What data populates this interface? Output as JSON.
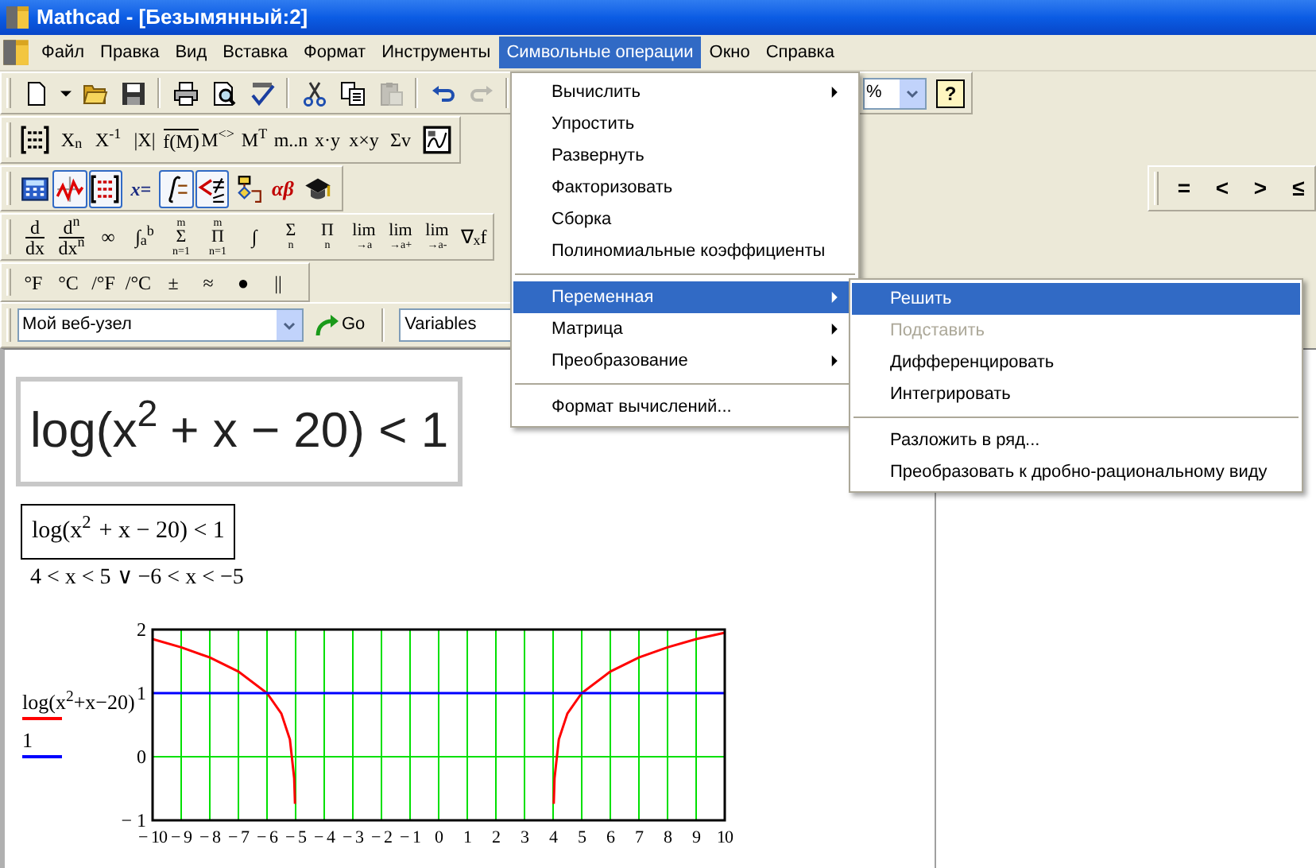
{
  "window": {
    "title": "Mathcad - [Безымянный:2]"
  },
  "menu_bar": [
    {
      "label": "Файл",
      "selected": false
    },
    {
      "label": "Правка",
      "selected": false
    },
    {
      "label": "Вид",
      "selected": false
    },
    {
      "label": "Вставка",
      "selected": false
    },
    {
      "label": "Формат",
      "selected": false
    },
    {
      "label": "Инструменты",
      "selected": false
    },
    {
      "label": "Символьные операции",
      "selected": true
    },
    {
      "label": "Окно",
      "selected": false
    },
    {
      "label": "Справка",
      "selected": false
    }
  ],
  "standard_toolbar": {
    "groups": [
      [
        {
          "kind": "new",
          "disabled": false
        },
        {
          "kind": "dropdown",
          "disabled": false
        },
        {
          "kind": "open",
          "disabled": false
        },
        {
          "kind": "save",
          "disabled": false
        }
      ],
      [
        {
          "kind": "print",
          "disabled": false
        },
        {
          "kind": "preview",
          "disabled": false
        },
        {
          "kind": "spell",
          "disabled": false
        }
      ],
      [
        {
          "kind": "cut",
          "disabled": false
        },
        {
          "kind": "copy",
          "disabled": false
        },
        {
          "kind": "paste",
          "disabled": true
        }
      ],
      [
        {
          "kind": "undo",
          "disabled": false
        },
        {
          "kind": "redo",
          "disabled": true
        }
      ]
    ],
    "zoom": "%",
    "help": "?"
  },
  "matrix_toolbar": [
    {
      "kind": "matrix"
    },
    {
      "kind": "text",
      "label": "X$_{n}$"
    },
    {
      "kind": "text",
      "label": "X$^{-1}$"
    },
    {
      "kind": "text",
      "label": "|X|"
    },
    {
      "kind": "vector",
      "label": "f(M)"
    },
    {
      "kind": "text",
      "label": "M$^{<>}$"
    },
    {
      "kind": "text",
      "label": "M$^{T}$"
    },
    {
      "kind": "text",
      "label": "m..n"
    },
    {
      "kind": "text",
      "label": "x·y"
    },
    {
      "kind": "text",
      "label": "x×y"
    },
    {
      "kind": "text",
      "label": "Σv"
    },
    {
      "kind": "picture_tool"
    }
  ],
  "math_toolbar": [
    {
      "kind": "calculator",
      "pressed": false
    },
    {
      "kind": "graph",
      "pressed": true
    },
    {
      "kind": "matrix_palette",
      "pressed": true
    },
    {
      "kind": "text",
      "label": "x=",
      "pressed": false
    },
    {
      "kind": "calculus",
      "pressed": true
    },
    {
      "kind": "boolean",
      "pressed": true
    },
    {
      "kind": "programming",
      "pressed": false
    },
    {
      "kind": "greek",
      "label": "αβ",
      "pressed": false
    },
    {
      "kind": "symbolic",
      "pressed": false
    }
  ],
  "calculus_toolbar": [
    {
      "kind": "frac",
      "top": "d",
      "bottom": "dx"
    },
    {
      "kind": "frac",
      "top": "d$^{n}$",
      "bottom": "dx$^{n}$"
    },
    {
      "kind": "text",
      "label": "∞"
    },
    {
      "kind": "text",
      "label": "∫$_{a}$$^{b}$"
    },
    {
      "kind": "stack",
      "top": "m",
      "mid": "Σ",
      "bottom": "n=1"
    },
    {
      "kind": "stack",
      "top": "m",
      "mid": "Π",
      "bottom": "n=1"
    },
    {
      "kind": "text",
      "label": "∫"
    },
    {
      "kind": "under",
      "mid": "Σ",
      "bottom": "n"
    },
    {
      "kind": "under",
      "mid": "Π",
      "bottom": "n"
    },
    {
      "kind": "under",
      "mid": "lim",
      "bottom": "→a"
    },
    {
      "kind": "under",
      "mid": "lim",
      "bottom": "→a+"
    },
    {
      "kind": "under",
      "mid": "lim",
      "bottom": "→a-"
    },
    {
      "kind": "text",
      "label": "∇$_{x}$f"
    }
  ],
  "units_toolbar": [
    "°F",
    "°C",
    "/°F",
    "/°C",
    "±",
    "≈",
    "●",
    "||"
  ],
  "boolean_toolbar": [
    "=",
    "<",
    ">",
    "≤"
  ],
  "resources_toolbar": {
    "site": "Мой веб-узел",
    "go": "Go",
    "variables": "Variables"
  },
  "worksheet": {
    "image_expression": "log(x$^{2}$ + x − 20) < 1",
    "expression": "log(x$^{2}$ + x − 20) < 1",
    "result": "4 < x < 5 ∨ −6 < x < −5",
    "plot": {
      "chart_data": {
        "type": "line",
        "grid": true,
        "xlim": [
          -10,
          10
        ],
        "ylim": [
          -1,
          2
        ],
        "x": [
          -10,
          -9,
          -8,
          -7,
          -6,
          -5.5,
          -5.2,
          -5.05,
          -5.02,
          0,
          4.02,
          4.05,
          4.2,
          4.5,
          5,
          6,
          7,
          8,
          9,
          10
        ],
        "series": [
          {
            "name": "log(x$^{2}$+x−20)",
            "color": "#ff0000",
            "values": [
              1.85,
              1.72,
              1.56,
              1.34,
              1,
              0.68,
              0.27,
              -0.34,
              -0.74,
              null,
              -0.74,
              -0.34,
              0.27,
              0.68,
              1,
              1.34,
              1.56,
              1.72,
              1.85,
              1.95
            ]
          },
          {
            "name": "1",
            "color": "#0000ff",
            "values": [
              1,
              1,
              1,
              1,
              1,
              1,
              1,
              1,
              1,
              1,
              1,
              1,
              1,
              1,
              1,
              1,
              1,
              1,
              1,
              1
            ]
          }
        ],
        "xticks": [
          {
            "value": -10,
            "label": "− 10"
          },
          {
            "value": -9,
            "label": "− 9"
          },
          {
            "value": -8,
            "label": "− 8"
          },
          {
            "value": -7,
            "label": "− 7"
          },
          {
            "value": -6,
            "label": "− 6"
          },
          {
            "value": -5,
            "label": "− 5"
          },
          {
            "value": -4,
            "label": "− 4"
          },
          {
            "value": -3,
            "label": "− 3"
          },
          {
            "value": -2,
            "label": "− 2"
          },
          {
            "value": -1,
            "label": "− 1"
          },
          0,
          1,
          2,
          3,
          4,
          5,
          6,
          7,
          8,
          9,
          10
        ],
        "yticks": [
          {
            "value": -1,
            "label": "− 1"
          },
          0,
          1,
          2
        ]
      }
    }
  },
  "symbolic_menu": [
    {
      "kind": "item",
      "label": "Вычислить",
      "submenu": true,
      "selected": false
    },
    {
      "kind": "item",
      "label": "Упростить",
      "submenu": false,
      "selected": false
    },
    {
      "kind": "item",
      "label": "Развернуть",
      "submenu": false,
      "selected": false
    },
    {
      "kind": "item",
      "label": "Факторизовать",
      "submenu": false,
      "selected": false
    },
    {
      "kind": "item",
      "label": "Сборка",
      "submenu": false,
      "selected": false
    },
    {
      "kind": "item",
      "label": "Полиномиальные коэффициенты",
      "submenu": false,
      "selected": false
    },
    {
      "kind": "separator"
    },
    {
      "kind": "item",
      "label": "Переменная",
      "submenu": true,
      "selected": true
    },
    {
      "kind": "item",
      "label": "Матрица",
      "submenu": true,
      "selected": false
    },
    {
      "kind": "item",
      "label": "Преобразование",
      "submenu": true,
      "selected": false
    },
    {
      "kind": "separator"
    },
    {
      "kind": "item",
      "label": "Формат вычислений...",
      "submenu": false,
      "selected": false
    }
  ],
  "variable_submenu": [
    {
      "kind": "item",
      "label": "Решить",
      "selected": true,
      "disabled": false
    },
    {
      "kind": "item",
      "label": "Подставить",
      "selected": false,
      "disabled": true
    },
    {
      "kind": "item",
      "label": "Дифференцировать",
      "selected": false,
      "disabled": false
    },
    {
      "kind": "item",
      "label": "Интегрировать",
      "selected": false,
      "disabled": false
    },
    {
      "kind": "separator"
    },
    {
      "kind": "item",
      "label": "Разложить в ряд...",
      "selected": false,
      "disabled": false
    },
    {
      "kind": "item",
      "label": "Преобразовать к дробно-рациональному виду",
      "selected": false,
      "disabled": false
    }
  ]
}
